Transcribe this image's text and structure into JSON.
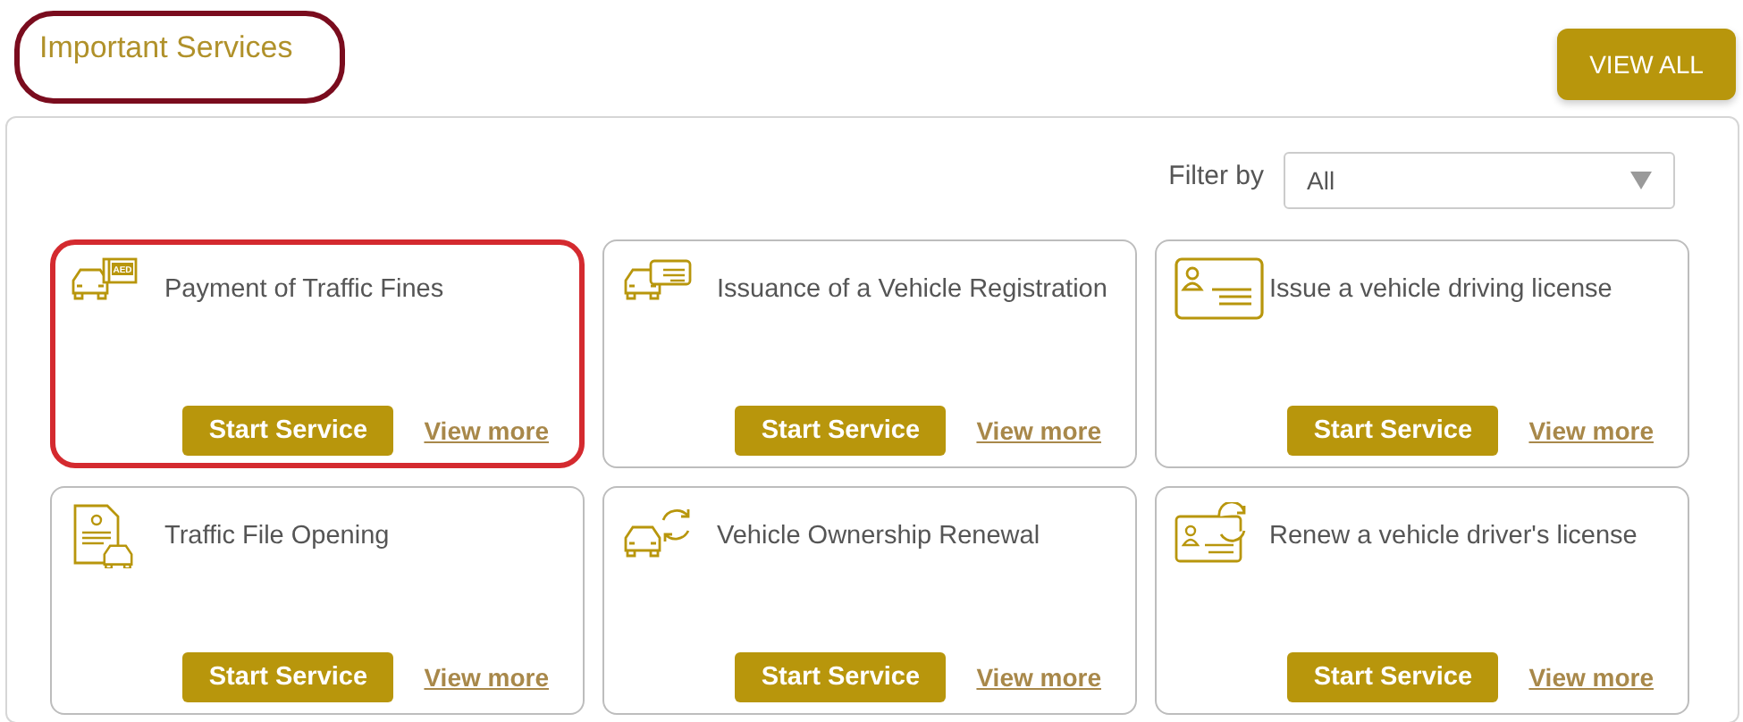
{
  "header": {
    "title": "Important Services",
    "title_highlighted": true,
    "view_all": "VIEW ALL"
  },
  "filter": {
    "label": "Filter by",
    "value": "All"
  },
  "services": [
    {
      "title": "Payment of Traffic Fines",
      "kind": "fines",
      "icon_text": "AED",
      "highlighted": true,
      "start": "Start Service",
      "more": "View more"
    },
    {
      "title": "Issuance of a Vehicle Registration",
      "kind": "registration",
      "highlighted": false,
      "start": "Start Service",
      "more": "View more"
    },
    {
      "title": "Issue a vehicle driving license",
      "kind": "license",
      "highlighted": false,
      "start": "Start Service",
      "more": "View more"
    },
    {
      "title": "Traffic File Opening",
      "kind": "file",
      "highlighted": false,
      "start": "Start Service",
      "more": "View more"
    },
    {
      "title": "Vehicle Ownership Renewal",
      "kind": "ownership",
      "highlighted": false,
      "start": "Start Service",
      "more": "View more"
    },
    {
      "title": "Renew a vehicle driver's license",
      "kind": "renewal",
      "highlighted": false,
      "start": "Start Service",
      "more": "View more"
    }
  ]
}
